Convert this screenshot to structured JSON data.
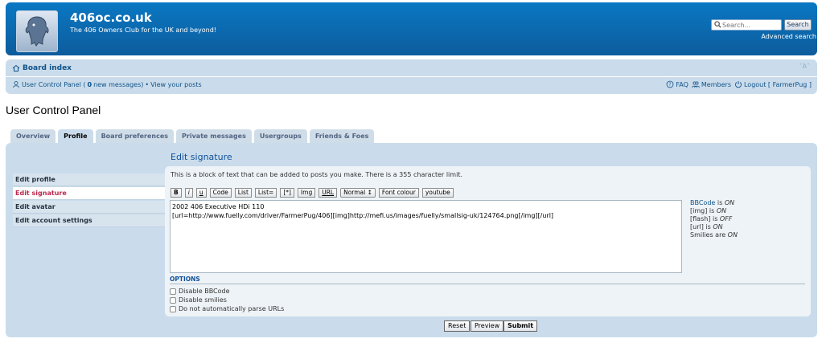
{
  "header": {
    "site_name": "406oc.co.uk",
    "site_description": "The 406 Owners Club for the UK and beyond!",
    "search_placeholder": "Search...",
    "search_button": "Search",
    "advanced_search": "Advanced search",
    "logo_icon": "lion-logo-icon"
  },
  "nav": {
    "board_index": "Board index",
    "font_resize": "˅A˄",
    "ucp_prefix": "User Control Panel (",
    "ucp_count": "0",
    "ucp_suffix": " new messages)",
    "separator": "•",
    "view_posts": "View your posts",
    "faq": "FAQ",
    "members": "Members",
    "logout": "Logout [ FarmerPug ]"
  },
  "page_title": "User Control Panel",
  "tabs": [
    {
      "label": "Overview"
    },
    {
      "label": "Profile",
      "active": true
    },
    {
      "label": "Board preferences"
    },
    {
      "label": "Private messages"
    },
    {
      "label": "Usergroups"
    },
    {
      "label": "Friends & Foes"
    }
  ],
  "menu": [
    {
      "label": "Edit profile"
    },
    {
      "label": "Edit signature",
      "active": true
    },
    {
      "label": "Edit avatar"
    },
    {
      "label": "Edit account settings"
    }
  ],
  "edit_signature": {
    "title": "Edit signature",
    "explain": "This is a block of text that can be added to posts you make. There is a 355 character limit.",
    "toolbar": [
      "B",
      "i",
      "u",
      "Code",
      "List",
      "List=",
      "[*]",
      "Img",
      "URL"
    ],
    "font_size_select": "Normal",
    "font_colour": "Font colour",
    "youtube": "youtube",
    "signature_text": "2002 406 Executive HDi 110\n[url=http://www.fuelly.com/driver/FarmerPug/406][img]http://mefi.us/images/fuelly/smallsig-uk/124764.png[/img][/url]",
    "status": {
      "bbcode_label": "BBCode",
      "bbcode_is": " is ",
      "bbcode_value": "ON",
      "img_label": "[img] is ",
      "img_value": "ON",
      "flash_label": "[flash] is ",
      "flash_value": "OFF",
      "url_label": "[url] is ",
      "url_value": "ON",
      "smilies_label": "Smilies are ",
      "smilies_value": "ON"
    },
    "options_title": "OPTIONS",
    "options": [
      "Disable BBCode",
      "Disable smilies",
      "Do not automatically parse URLs"
    ],
    "buttons": {
      "reset": "Reset",
      "preview": "Preview",
      "submit": "Submit"
    }
  },
  "colors": {
    "header_blue": "#0d6fb8",
    "panel_bg": "#cadceb",
    "link": "#105289",
    "active_menu": "#bc2a4d"
  }
}
